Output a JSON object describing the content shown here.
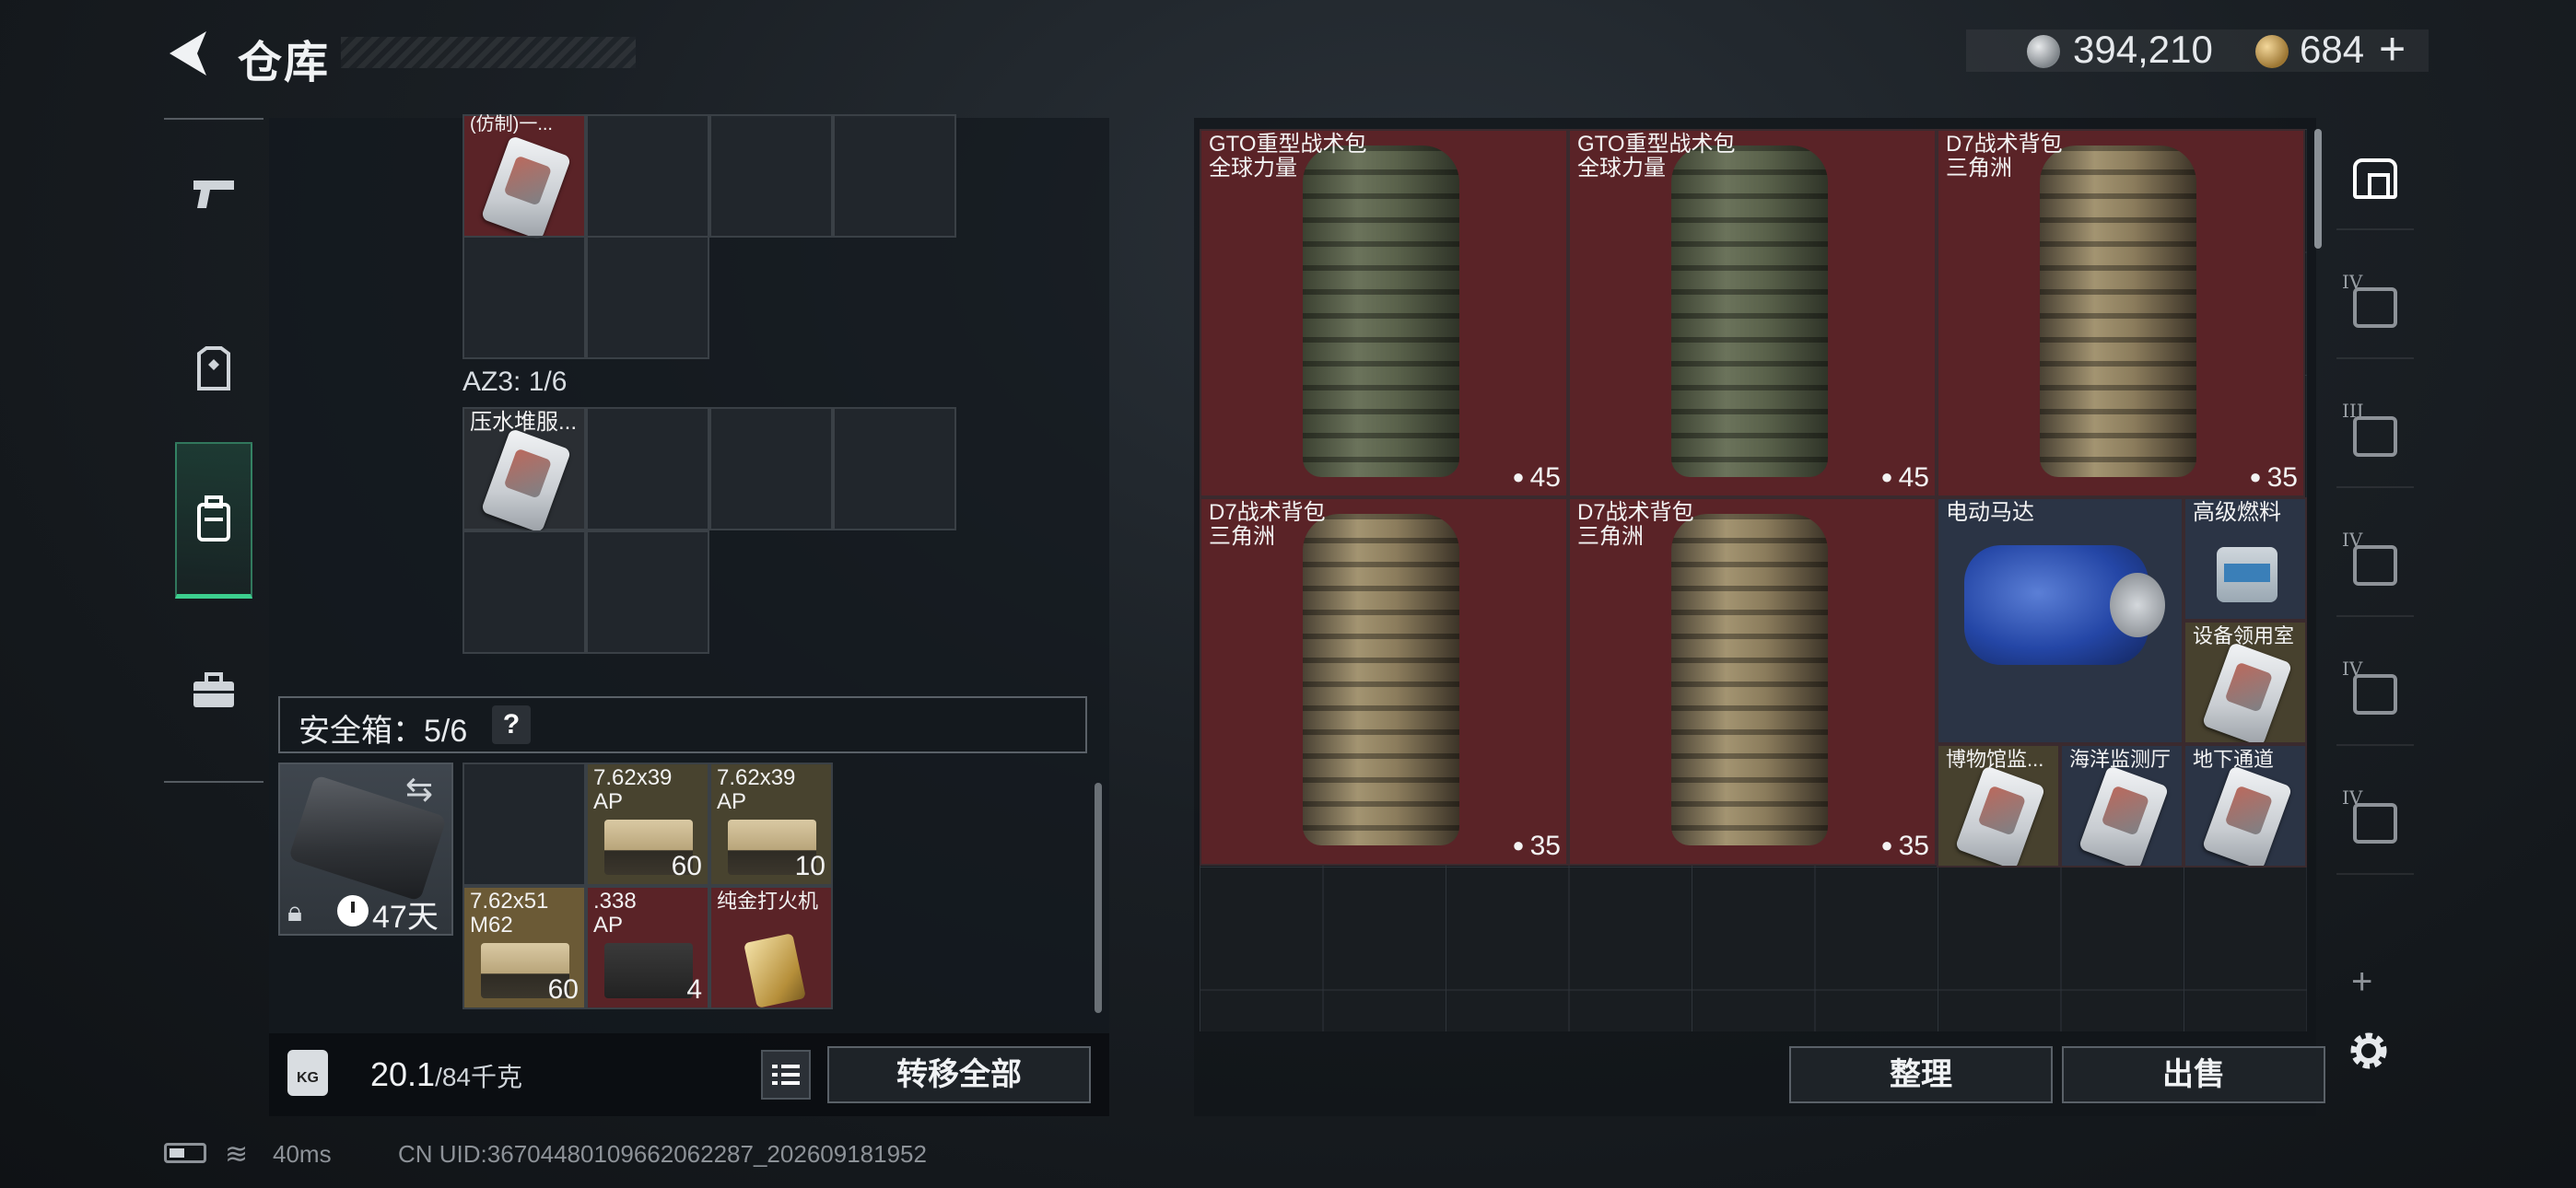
{
  "header": {
    "title": "仓库",
    "silver_amount": "394,210",
    "gold_amount": "684",
    "gold_plus": "+"
  },
  "left_nav": {
    "items": [
      {
        "icon": "pistol-icon"
      },
      {
        "icon": "armor-vest-icon"
      },
      {
        "icon": "backpack-icon",
        "active": true
      },
      {
        "icon": "toolbox-icon"
      }
    ]
  },
  "loadout": {
    "top_item_label": "(仿制)一...",
    "az3_label": "AZ3: 1/6",
    "az3_item_label": "压水堆服...",
    "safebox_label": "安全箱：5/6",
    "help": "?",
    "days_left": "47天",
    "safebox_items": [
      {
        "label": "7.62x39\nAP",
        "count": "60"
      },
      {
        "label": "7.62x39\nAP",
        "count": "10"
      },
      {
        "label": "7.62x51\nM62",
        "count": "60"
      },
      {
        "label": ".338\nAP",
        "count": "4"
      },
      {
        "label": "纯金打火机",
        "count": ""
      }
    ],
    "weight": "20.1",
    "weight_max": "/84千克",
    "transfer_all": "转移全部"
  },
  "storage": {
    "items": [
      {
        "label": "GTO重型战术包\n全球力量",
        "count": "45"
      },
      {
        "label": "GTO重型战术包\n全球力量",
        "count": "45"
      },
      {
        "label": "D7战术背包\n三角洲",
        "count": "35"
      },
      {
        "label": "D7战术背包\n三角洲",
        "count": "35"
      },
      {
        "label": "D7战术背包\n三角洲",
        "count": "35"
      },
      {
        "label": "电动马达",
        "count": ""
      },
      {
        "label": "高级燃料",
        "count": ""
      },
      {
        "label": "设备领用室",
        "count": ""
      },
      {
        "label": "博物馆监...",
        "count": ""
      },
      {
        "label": "海洋监测厅",
        "count": ""
      },
      {
        "label": "地下通道",
        "count": ""
      }
    ],
    "sort": "整理",
    "sell": "出售",
    "tabs": [
      {
        "tier": "",
        "icon": "vault-icon",
        "active": true
      },
      {
        "tier": "IV",
        "icon": "storage-case-icon"
      },
      {
        "tier": "III",
        "icon": "storage-case-icon"
      },
      {
        "tier": "IV",
        "icon": "storage-case-icon"
      },
      {
        "tier": "IV",
        "icon": "storage-case-icon"
      },
      {
        "tier": "IV",
        "icon": "storage-case-icon"
      }
    ],
    "add_tab": "+"
  },
  "status_bar": {
    "ping": "40ms",
    "uid": "CN UID:3670448010966206228​7_202609181952"
  },
  "colors": {
    "accent_green": "#3ccf8e",
    "item_red": "#5a2327",
    "item_blue": "#2b3445"
  }
}
